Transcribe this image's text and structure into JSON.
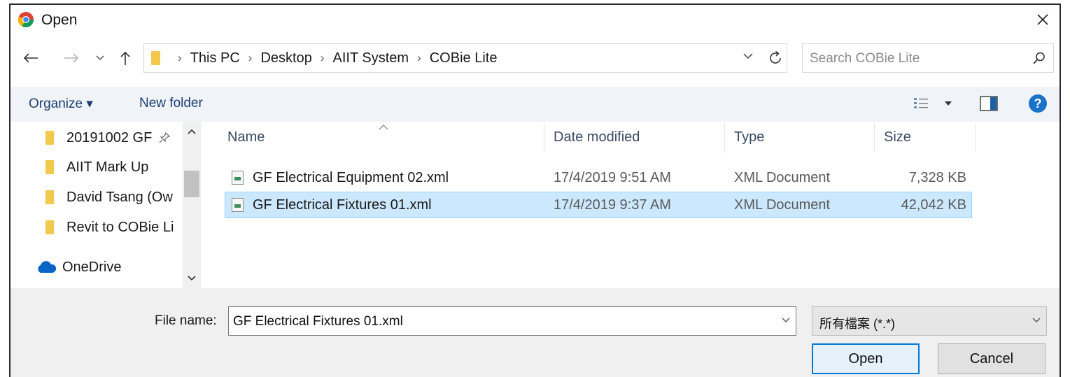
{
  "window": {
    "title": "Open"
  },
  "address": {
    "crumbs": [
      "This PC",
      "Desktop",
      "AIIT System",
      "COBie Lite"
    ]
  },
  "search": {
    "placeholder": "Search COBie Lite"
  },
  "toolbar": {
    "organize_label": "Organize ▾",
    "new_folder_label": "New folder"
  },
  "nav": {
    "items": [
      {
        "label": "20191002 GF",
        "icon": "folder-icon",
        "pinned": true
      },
      {
        "label": "AIIT Mark Up",
        "icon": "folder-icon"
      },
      {
        "label": "David Tsang (Ow",
        "icon": "folder-icon"
      },
      {
        "label": "Revit to COBie Li",
        "icon": "folder-icon"
      },
      {
        "label": "OneDrive",
        "icon": "cloud-icon"
      }
    ]
  },
  "files": {
    "columns": {
      "name": "Name",
      "date": "Date modified",
      "type": "Type",
      "size": "Size"
    },
    "rows": [
      {
        "name": "GF Electrical Equipment 02.xml",
        "date": "17/4/2019 9:51 AM",
        "type": "XML Document",
        "size": "7,328 KB",
        "selected": false
      },
      {
        "name": "GF Electrical Fixtures 01.xml",
        "date": "17/4/2019 9:37 AM",
        "type": "XML Document",
        "size": "42,042 KB",
        "selected": true
      }
    ]
  },
  "footer": {
    "file_name_label": "File name:",
    "file_name_value": "GF Electrical Fixtures 01.xml",
    "file_type_value": "所有檔案 (*.*)",
    "open_label": "Open",
    "cancel_label": "Cancel"
  },
  "colors": {
    "accent": "#0078d7",
    "selection": "#cce8ff",
    "toolbar_bg": "#f0f4f9",
    "help": "#1a73c9"
  }
}
